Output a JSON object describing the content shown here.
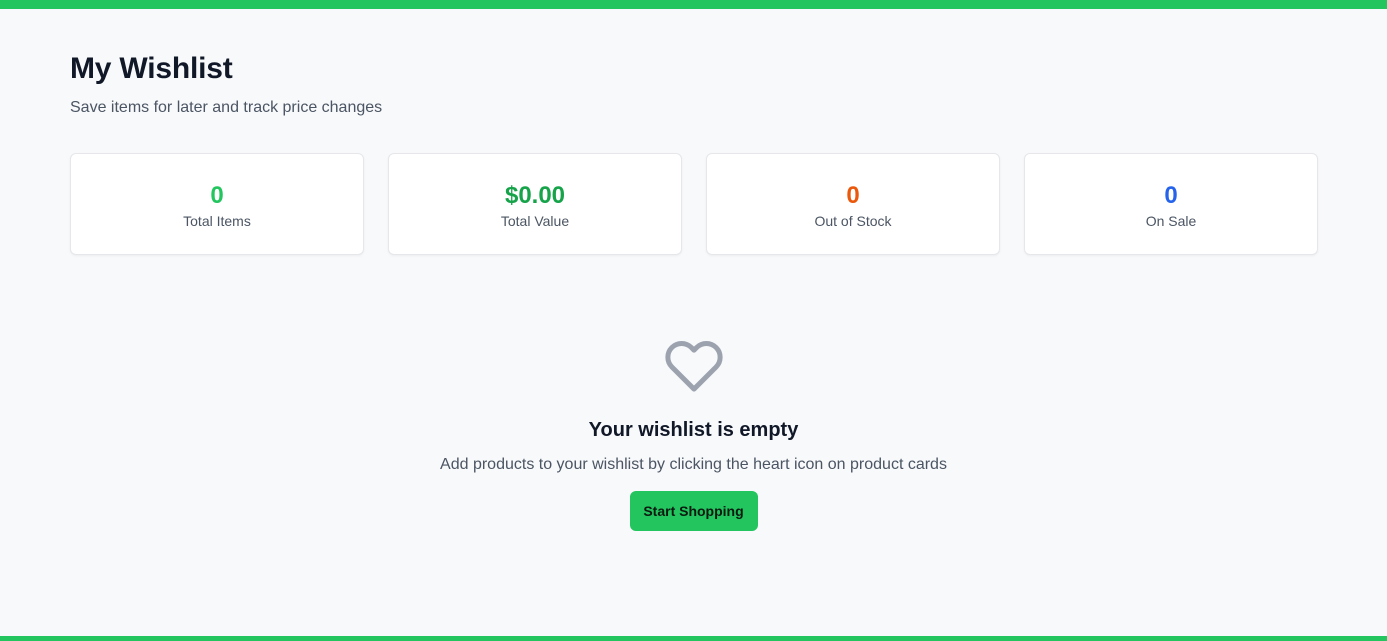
{
  "header": {
    "title": "My Wishlist",
    "subtitle": "Save items for later and track price changes"
  },
  "stats": [
    {
      "value": "0",
      "label": "Total Items",
      "color": "#22c55e"
    },
    {
      "value": "$0.00",
      "label": "Total Value",
      "color": "#16a34a"
    },
    {
      "value": "0",
      "label": "Out of Stock",
      "color": "#ea580c"
    },
    {
      "value": "0",
      "label": "On Sale",
      "color": "#2563eb"
    }
  ],
  "empty_state": {
    "icon": "heart-icon",
    "title": "Your wishlist is empty",
    "description": "Add products to your wishlist by clicking the heart icon on product cards",
    "button_label": "Start Shopping"
  },
  "colors": {
    "accent": "#22c55e",
    "icon_gray": "#9ca3af",
    "background": "#f8f9fb"
  }
}
